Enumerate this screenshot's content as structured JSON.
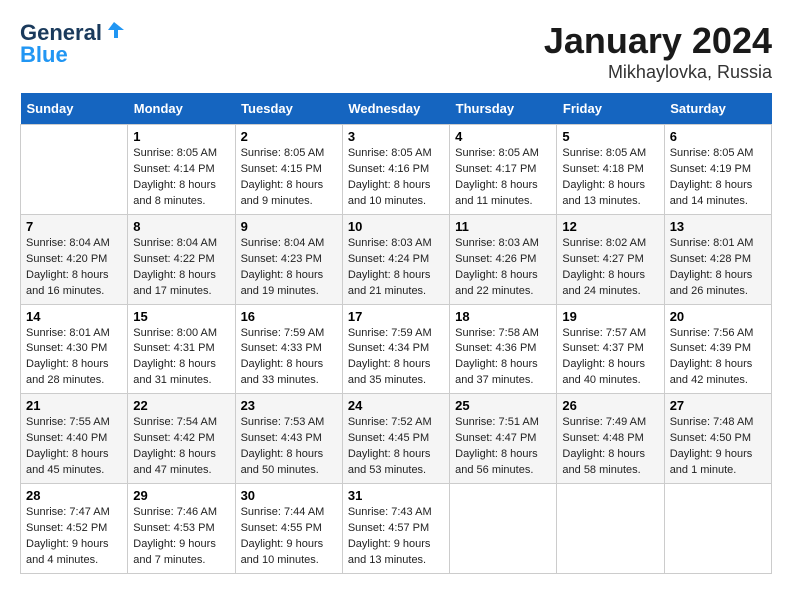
{
  "logo": {
    "line1": "General",
    "line2": "Blue"
  },
  "title": "January 2024",
  "subtitle": "Mikhaylovka, Russia",
  "header_days": [
    "Sunday",
    "Monday",
    "Tuesday",
    "Wednesday",
    "Thursday",
    "Friday",
    "Saturday"
  ],
  "weeks": [
    [
      {
        "day": "",
        "info": ""
      },
      {
        "day": "1",
        "info": "Sunrise: 8:05 AM\nSunset: 4:14 PM\nDaylight: 8 hours\nand 8 minutes."
      },
      {
        "day": "2",
        "info": "Sunrise: 8:05 AM\nSunset: 4:15 PM\nDaylight: 8 hours\nand 9 minutes."
      },
      {
        "day": "3",
        "info": "Sunrise: 8:05 AM\nSunset: 4:16 PM\nDaylight: 8 hours\nand 10 minutes."
      },
      {
        "day": "4",
        "info": "Sunrise: 8:05 AM\nSunset: 4:17 PM\nDaylight: 8 hours\nand 11 minutes."
      },
      {
        "day": "5",
        "info": "Sunrise: 8:05 AM\nSunset: 4:18 PM\nDaylight: 8 hours\nand 13 minutes."
      },
      {
        "day": "6",
        "info": "Sunrise: 8:05 AM\nSunset: 4:19 PM\nDaylight: 8 hours\nand 14 minutes."
      }
    ],
    [
      {
        "day": "7",
        "info": "Sunrise: 8:04 AM\nSunset: 4:20 PM\nDaylight: 8 hours\nand 16 minutes."
      },
      {
        "day": "8",
        "info": "Sunrise: 8:04 AM\nSunset: 4:22 PM\nDaylight: 8 hours\nand 17 minutes."
      },
      {
        "day": "9",
        "info": "Sunrise: 8:04 AM\nSunset: 4:23 PM\nDaylight: 8 hours\nand 19 minutes."
      },
      {
        "day": "10",
        "info": "Sunrise: 8:03 AM\nSunset: 4:24 PM\nDaylight: 8 hours\nand 21 minutes."
      },
      {
        "day": "11",
        "info": "Sunrise: 8:03 AM\nSunset: 4:26 PM\nDaylight: 8 hours\nand 22 minutes."
      },
      {
        "day": "12",
        "info": "Sunrise: 8:02 AM\nSunset: 4:27 PM\nDaylight: 8 hours\nand 24 minutes."
      },
      {
        "day": "13",
        "info": "Sunrise: 8:01 AM\nSunset: 4:28 PM\nDaylight: 8 hours\nand 26 minutes."
      }
    ],
    [
      {
        "day": "14",
        "info": "Sunrise: 8:01 AM\nSunset: 4:30 PM\nDaylight: 8 hours\nand 28 minutes."
      },
      {
        "day": "15",
        "info": "Sunrise: 8:00 AM\nSunset: 4:31 PM\nDaylight: 8 hours\nand 31 minutes."
      },
      {
        "day": "16",
        "info": "Sunrise: 7:59 AM\nSunset: 4:33 PM\nDaylight: 8 hours\nand 33 minutes."
      },
      {
        "day": "17",
        "info": "Sunrise: 7:59 AM\nSunset: 4:34 PM\nDaylight: 8 hours\nand 35 minutes."
      },
      {
        "day": "18",
        "info": "Sunrise: 7:58 AM\nSunset: 4:36 PM\nDaylight: 8 hours\nand 37 minutes."
      },
      {
        "day": "19",
        "info": "Sunrise: 7:57 AM\nSunset: 4:37 PM\nDaylight: 8 hours\nand 40 minutes."
      },
      {
        "day": "20",
        "info": "Sunrise: 7:56 AM\nSunset: 4:39 PM\nDaylight: 8 hours\nand 42 minutes."
      }
    ],
    [
      {
        "day": "21",
        "info": "Sunrise: 7:55 AM\nSunset: 4:40 PM\nDaylight: 8 hours\nand 45 minutes."
      },
      {
        "day": "22",
        "info": "Sunrise: 7:54 AM\nSunset: 4:42 PM\nDaylight: 8 hours\nand 47 minutes."
      },
      {
        "day": "23",
        "info": "Sunrise: 7:53 AM\nSunset: 4:43 PM\nDaylight: 8 hours\nand 50 minutes."
      },
      {
        "day": "24",
        "info": "Sunrise: 7:52 AM\nSunset: 4:45 PM\nDaylight: 8 hours\nand 53 minutes."
      },
      {
        "day": "25",
        "info": "Sunrise: 7:51 AM\nSunset: 4:47 PM\nDaylight: 8 hours\nand 56 minutes."
      },
      {
        "day": "26",
        "info": "Sunrise: 7:49 AM\nSunset: 4:48 PM\nDaylight: 8 hours\nand 58 minutes."
      },
      {
        "day": "27",
        "info": "Sunrise: 7:48 AM\nSunset: 4:50 PM\nDaylight: 9 hours\nand 1 minute."
      }
    ],
    [
      {
        "day": "28",
        "info": "Sunrise: 7:47 AM\nSunset: 4:52 PM\nDaylight: 9 hours\nand 4 minutes."
      },
      {
        "day": "29",
        "info": "Sunrise: 7:46 AM\nSunset: 4:53 PM\nDaylight: 9 hours\nand 7 minutes."
      },
      {
        "day": "30",
        "info": "Sunrise: 7:44 AM\nSunset: 4:55 PM\nDaylight: 9 hours\nand 10 minutes."
      },
      {
        "day": "31",
        "info": "Sunrise: 7:43 AM\nSunset: 4:57 PM\nDaylight: 9 hours\nand 13 minutes."
      },
      {
        "day": "",
        "info": ""
      },
      {
        "day": "",
        "info": ""
      },
      {
        "day": "",
        "info": ""
      }
    ]
  ]
}
